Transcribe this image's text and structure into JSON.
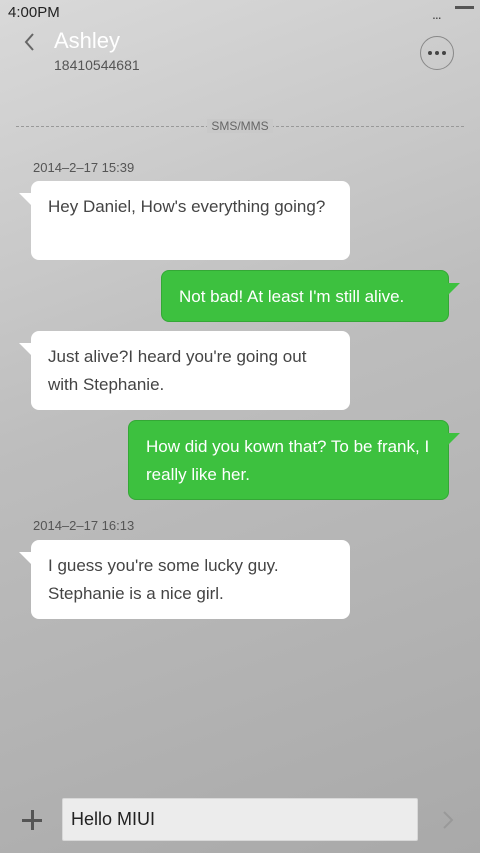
{
  "status": {
    "time": "4:00PM",
    "dots": "..."
  },
  "header": {
    "name": "Ashley",
    "number": "18410544681",
    "back_icon": "chevron-left-icon",
    "more_icon": "more-options-icon"
  },
  "divider": {
    "label": "SMS/MMS"
  },
  "conversation": {
    "timestamps": [
      "2014–2–17 15:39",
      "2014–2–17 16:13"
    ],
    "messages": [
      {
        "direction": "in",
        "text": "Hey Daniel, How's everything going?"
      },
      {
        "direction": "out",
        "text": "Not bad! At least I'm still alive."
      },
      {
        "direction": "in",
        "text": "Just  alive?I heard you're going out with Stephanie."
      },
      {
        "direction": "out",
        "text": "How did you kown that? To be frank, I really like her."
      },
      {
        "direction": "in",
        "text": "I guess you're some lucky guy. Stephanie is a nice girl."
      }
    ]
  },
  "composer": {
    "value": "Hello MIUI",
    "add_icon": "plus-icon",
    "send_icon": "send-arrow-icon"
  },
  "colors": {
    "incoming_bubble": "#ffffff",
    "outgoing_bubble": "#3dc13f",
    "contact_name": "#ffffff"
  }
}
